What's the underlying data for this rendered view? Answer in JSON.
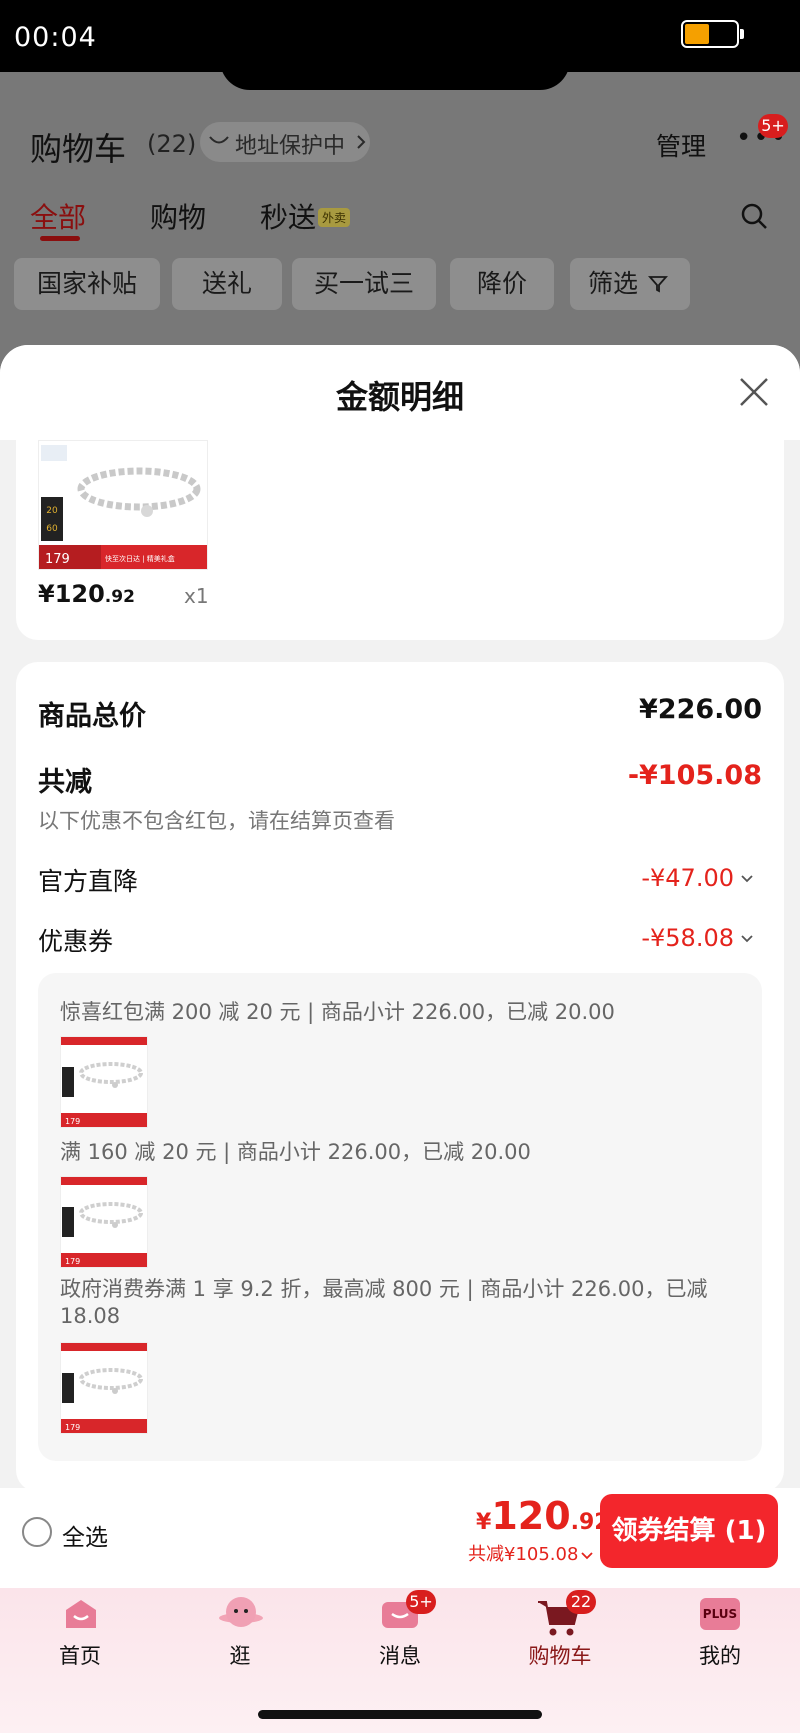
{
  "status": {
    "time": "00:04"
  },
  "header": {
    "title": "购物车",
    "count": "(22)",
    "address_protect": "地址保护中",
    "manage": "管理",
    "more_badge": "5+"
  },
  "tabs": [
    {
      "label": "全部"
    },
    {
      "label": "购物"
    },
    {
      "label": "秒送"
    }
  ],
  "tab_tag": "外卖",
  "filters": [
    "国家补贴",
    "送礼",
    "买一试三",
    "降价",
    "筛选"
  ],
  "modal": {
    "title": "金额明细",
    "product": {
      "price_int": "¥120",
      "price_dec": ".92",
      "qty": "x1"
    },
    "summary": {
      "goods_total_label": "商品总价",
      "goods_total_value": "¥226.00",
      "reduce_label": "共减",
      "reduce_value": "-¥105.08",
      "note": "以下优惠不包含红包，请在结算页查看",
      "official_label": "官方直降",
      "official_value": "-¥47.00",
      "coupon_label": "优惠券",
      "coupon_value": "-¥58.08"
    },
    "coupons": [
      {
        "text": "惊喜红包满 200 减 20 元 | 商品小计 226.00，已减 20.00"
      },
      {
        "text": "满 160 减 20 元 | 商品小计 226.00，已减 20.00"
      },
      {
        "text": "政府消费券满 1 享 9.2 折，最高减 800 元 | 商品小计 226.00，已减 18.08"
      }
    ],
    "thumb_price": "179",
    "thumb_banner": "快至次日达 | 精美礼盒"
  },
  "bottom": {
    "select_all": "全选",
    "total_yen": "¥",
    "total_int": "120",
    "total_dec": ".92",
    "saved": "共减¥105.08",
    "checkout": "领券结算 (1)"
  },
  "tabbar": [
    {
      "label": "首页",
      "icon": "home-icon"
    },
    {
      "label": "逛",
      "icon": "explore-icon"
    },
    {
      "label": "消息",
      "icon": "message-icon",
      "badge": "5+"
    },
    {
      "label": "购物车",
      "icon": "cart-icon",
      "badge": "22"
    },
    {
      "label": "我的",
      "icon": "plus-member-icon",
      "plus": "PLUS"
    }
  ],
  "colors": {
    "accent": "#e4231c",
    "button": "#f3262c",
    "active_tab": "#8a0f0f"
  }
}
